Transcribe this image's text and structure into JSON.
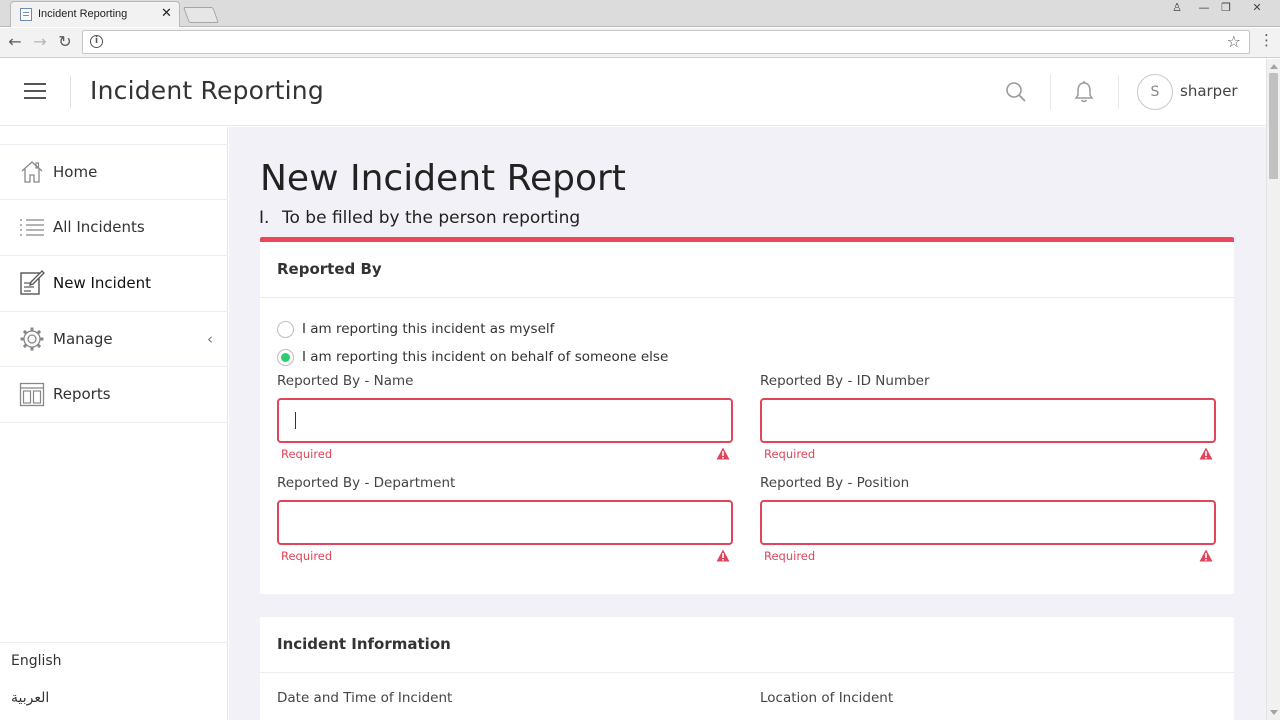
{
  "browser": {
    "tab_title": "Incident Reporting",
    "tab_close": "✕",
    "window_controls": [
      "♙",
      "—",
      "❐",
      "✕"
    ],
    "nav": {
      "back": "←",
      "forward": "→",
      "reload": "↻"
    },
    "url": "",
    "info_glyph": "i",
    "star_glyph": "☆",
    "menu_glyph": "⋮"
  },
  "header": {
    "app_title": "Incident Reporting",
    "avatar_initial": "S",
    "username": "sharper"
  },
  "sidebar": {
    "items": [
      {
        "label": "Home",
        "icon": "home-icon"
      },
      {
        "label": "All Incidents",
        "icon": "list-icon"
      },
      {
        "label": "New Incident",
        "icon": "new-document-icon",
        "active": true
      },
      {
        "label": "Manage",
        "icon": "gear-icon",
        "chevron": "‹"
      },
      {
        "label": "Reports",
        "icon": "reports-icon"
      }
    ],
    "languages": [
      "English",
      "العربية"
    ]
  },
  "main": {
    "page_title": "New Incident Report",
    "section_number": "I.",
    "section_title": "To be filled by the person reporting",
    "reported_by": {
      "title": "Reported By",
      "options": [
        {
          "label": "I am reporting this incident as myself",
          "checked": false
        },
        {
          "label": "I am reporting this incident on behalf of someone else",
          "checked": true
        }
      ],
      "fields": [
        {
          "label": "Reported By - Name",
          "value": "",
          "error": "Required"
        },
        {
          "label": "Reported By - ID Number",
          "value": "",
          "error": "Required"
        },
        {
          "label": "Reported By - Department",
          "value": "",
          "error": "Required"
        },
        {
          "label": "Reported By - Position",
          "value": "",
          "error": "Required"
        }
      ]
    },
    "incident_info": {
      "title": "Incident Information",
      "fields": [
        {
          "label": "Date and Time of Incident"
        },
        {
          "label": "Location of Incident"
        }
      ]
    }
  },
  "colors": {
    "accent_red": "#f0465a",
    "error_red": "#e0455a",
    "radio_green": "#2ecc71",
    "content_bg": "#f1f1f7"
  }
}
